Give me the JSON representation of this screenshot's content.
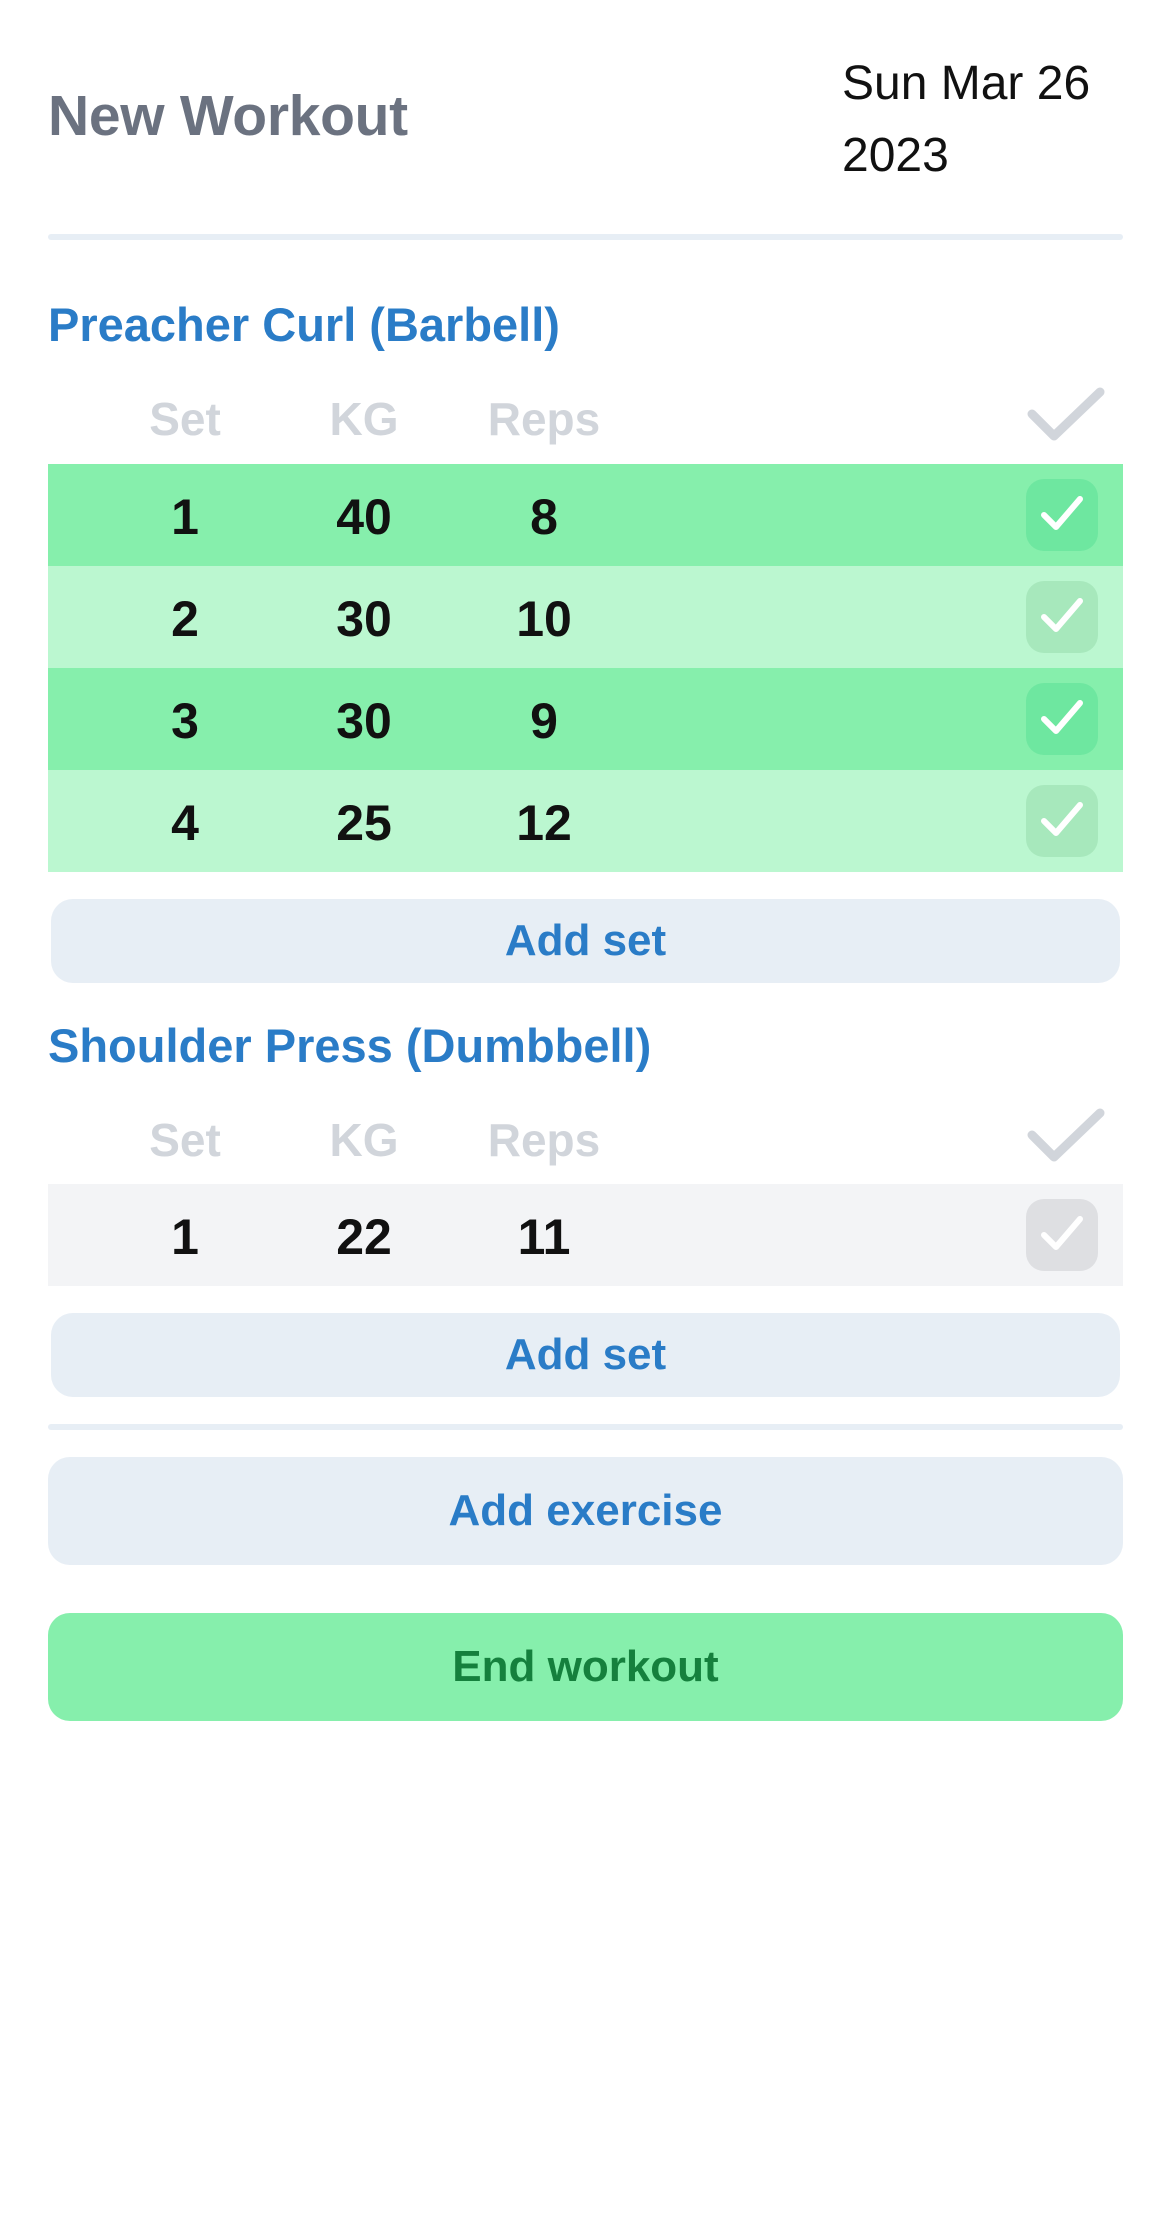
{
  "header": {
    "title": "New Workout",
    "date_line1": "Sun Mar 26",
    "date_line2": "2023"
  },
  "columns": {
    "set": "Set",
    "kg": "KG",
    "reps": "Reps"
  },
  "exercises": [
    {
      "name": "Preacher Curl (Barbell)",
      "add_set_label": "Add set",
      "sets": [
        {
          "set": "1",
          "kg": "40",
          "reps": "8",
          "completed": true
        },
        {
          "set": "2",
          "kg": "30",
          "reps": "10",
          "completed": true
        },
        {
          "set": "3",
          "kg": "30",
          "reps": "9",
          "completed": true
        },
        {
          "set": "4",
          "kg": "25",
          "reps": "12",
          "completed": true
        }
      ]
    },
    {
      "name": "Shoulder Press (Dumbbell)",
      "add_set_label": "Add set",
      "sets": [
        {
          "set": "1",
          "kg": "22",
          "reps": "11",
          "completed": false
        }
      ]
    }
  ],
  "actions": {
    "add_exercise": "Add exercise",
    "end_workout": "End workout"
  },
  "colors": {
    "accent": "#2a7cc7",
    "completed_row_dark": "#86efac",
    "completed_row_light": "#bbf7d0",
    "incomplete_row": "#f3f4f6",
    "end_workout_text": "#15803d"
  },
  "icons": {
    "header_check": "checkmark-icon",
    "row_check": "checkbox-checkmark-icon"
  }
}
